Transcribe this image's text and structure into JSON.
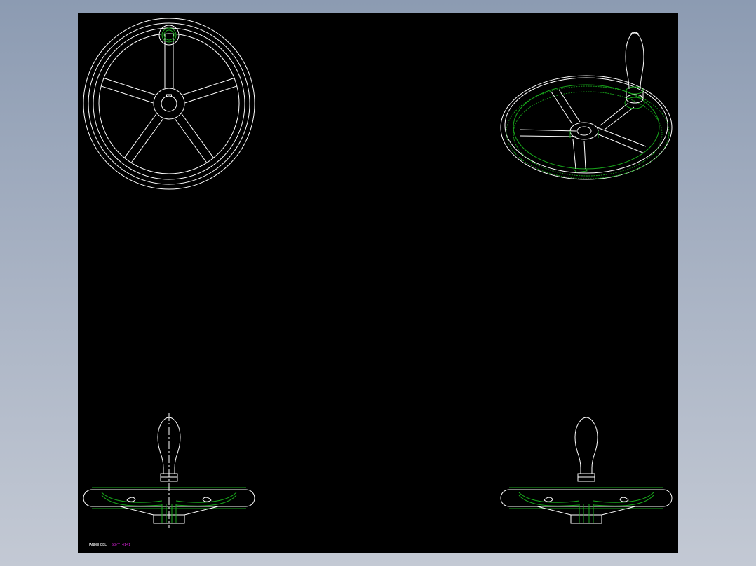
{
  "canvas": {
    "background": "#000000",
    "line_color": "#ffffff",
    "hidden_color": "#19a81c",
    "note_color": "#d020d0"
  },
  "views": [
    {
      "id": "front-view",
      "kind": "front",
      "spokes": 5
    },
    {
      "id": "isometric-view",
      "kind": "isometric",
      "spokes": 4
    },
    {
      "id": "side-view-left",
      "kind": "side"
    },
    {
      "id": "side-view-right",
      "kind": "side"
    }
  ],
  "title_block": {
    "label": "HANDWHEEL",
    "note": "GB/T 4141"
  }
}
